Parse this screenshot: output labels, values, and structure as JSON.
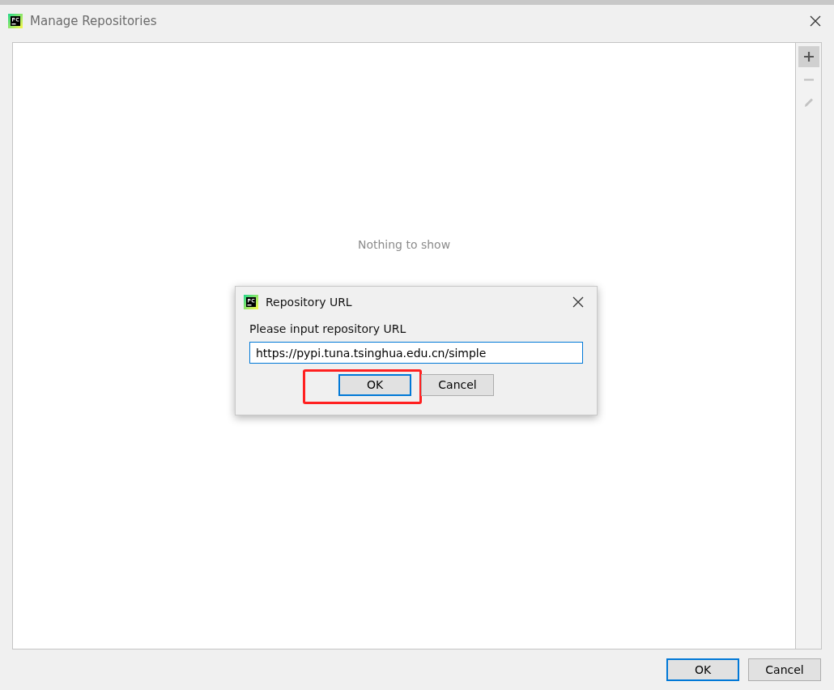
{
  "window": {
    "title": "Manage Repositories"
  },
  "list": {
    "empty_text": "Nothing to show"
  },
  "tools": [
    {
      "kind": "add",
      "disabled": false,
      "hovered": true
    },
    {
      "kind": "remove",
      "disabled": true,
      "hovered": false
    },
    {
      "kind": "edit",
      "disabled": true,
      "hovered": false
    }
  ],
  "buttons": [
    {
      "label": "OK",
      "default": true
    },
    {
      "label": "Cancel",
      "default": false
    }
  ],
  "dialog": {
    "title": "Repository URL",
    "prompt": "Please input repository URL",
    "url_value": "https://pypi.tuna.tsinghua.edu.cn/simple",
    "buttons": [
      {
        "label": "OK",
        "default": true,
        "highlighted": true
      },
      {
        "label": "Cancel",
        "default": false,
        "highlighted": false
      }
    ]
  }
}
